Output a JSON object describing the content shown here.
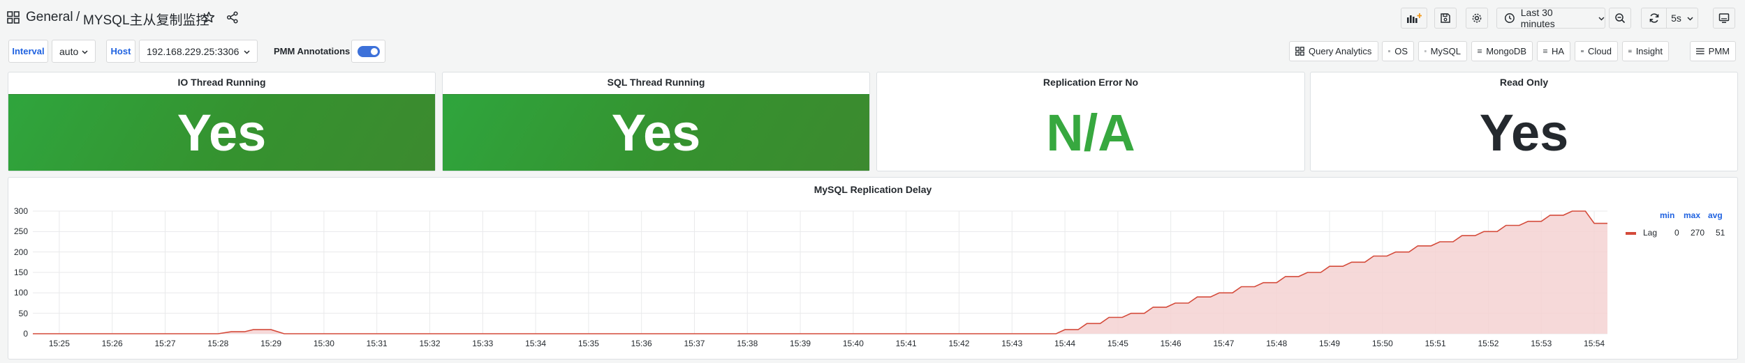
{
  "header": {
    "breadcrumb_root": "General",
    "breadcrumb_sep": "/",
    "dashboard_title": "MYSQL主从复制监控",
    "time_range": "Last 30 minutes",
    "refresh_interval": "5s"
  },
  "variables": {
    "interval_label": "Interval",
    "interval_value": "auto",
    "host_label": "Host",
    "host_value": "192.168.229.25:3306",
    "annotations_label": "PMM Annotations",
    "annotations_enabled": true
  },
  "links": [
    {
      "label": "Query Analytics",
      "icon": "apps-icon"
    },
    {
      "label": "OS",
      "icon": "bars-icon"
    },
    {
      "label": "MySQL",
      "icon": "bars-icon"
    },
    {
      "label": "MongoDB",
      "icon": "bars-icon"
    },
    {
      "label": "HA",
      "icon": "bars-icon"
    },
    {
      "label": "Cloud",
      "icon": "bars-icon"
    },
    {
      "label": "Insight",
      "icon": "bars-icon"
    },
    {
      "label": "PMM",
      "icon": "bars-icon"
    }
  ],
  "stats": [
    {
      "title": "IO Thread Running",
      "value": "Yes"
    },
    {
      "title": "SQL Thread Running",
      "value": "Yes"
    },
    {
      "title": "Replication Error No",
      "value": "N/A"
    },
    {
      "title": "Read Only",
      "value": "Yes"
    }
  ],
  "colors": {
    "ok_green": "#2fa53d",
    "na_green": "#37a83f",
    "lag_line": "#d44a3a",
    "lag_fill": "#f5d2d2",
    "accent_blue": "#1f62e0"
  },
  "chart_data": {
    "type": "area",
    "title": "MySQL Replication Delay",
    "xlabel": "",
    "ylabel": "",
    "ylim": [
      0,
      300
    ],
    "y_ticks": [
      "300",
      "250",
      "200",
      "150",
      "100",
      "50",
      "0"
    ],
    "x_ticks": [
      "15:25",
      "15:26",
      "15:27",
      "15:28",
      "15:29",
      "15:30",
      "15:31",
      "15:32",
      "15:33",
      "15:34",
      "15:35",
      "15:36",
      "15:37",
      "15:38",
      "15:39",
      "15:40",
      "15:41",
      "15:42",
      "15:43",
      "15:44",
      "15:45",
      "15:46",
      "15:47",
      "15:48",
      "15:49",
      "15:50",
      "15:51",
      "15:52",
      "15:53",
      "15:54"
    ],
    "grid": true,
    "legend_position": "right",
    "series": [
      {
        "name": "Lag",
        "color": "#d44a3a",
        "legend": {
          "min": "0",
          "max": "270",
          "avg": "51"
        },
        "points": [
          [
            "15:24:30",
            0
          ],
          [
            "15:28:00",
            0
          ],
          [
            "15:28:15",
            5
          ],
          [
            "15:28:30",
            5
          ],
          [
            "15:28:40",
            10
          ],
          [
            "15:29:00",
            10
          ],
          [
            "15:29:15",
            0
          ],
          [
            "15:43:50",
            0
          ],
          [
            "15:44:00",
            10
          ],
          [
            "15:44:15",
            10
          ],
          [
            "15:44:25",
            25
          ],
          [
            "15:44:40",
            25
          ],
          [
            "15:44:50",
            40
          ],
          [
            "15:45:05",
            40
          ],
          [
            "15:45:15",
            50
          ],
          [
            "15:45:30",
            50
          ],
          [
            "15:45:40",
            65
          ],
          [
            "15:45:55",
            65
          ],
          [
            "15:46:05",
            75
          ],
          [
            "15:46:20",
            75
          ],
          [
            "15:46:30",
            90
          ],
          [
            "15:46:45",
            90
          ],
          [
            "15:46:55",
            100
          ],
          [
            "15:47:10",
            100
          ],
          [
            "15:47:20",
            115
          ],
          [
            "15:47:35",
            115
          ],
          [
            "15:47:45",
            125
          ],
          [
            "15:48:00",
            125
          ],
          [
            "15:48:10",
            140
          ],
          [
            "15:48:25",
            140
          ],
          [
            "15:48:35",
            150
          ],
          [
            "15:48:50",
            150
          ],
          [
            "15:49:00",
            165
          ],
          [
            "15:49:15",
            165
          ],
          [
            "15:49:25",
            175
          ],
          [
            "15:49:40",
            175
          ],
          [
            "15:49:50",
            190
          ],
          [
            "15:50:05",
            190
          ],
          [
            "15:50:15",
            200
          ],
          [
            "15:50:30",
            200
          ],
          [
            "15:50:40",
            215
          ],
          [
            "15:50:55",
            215
          ],
          [
            "15:51:05",
            225
          ],
          [
            "15:51:20",
            225
          ],
          [
            "15:51:30",
            240
          ],
          [
            "15:51:45",
            240
          ],
          [
            "15:51:55",
            250
          ],
          [
            "15:52:10",
            250
          ],
          [
            "15:52:20",
            265
          ],
          [
            "15:52:35",
            265
          ],
          [
            "15:52:45",
            275
          ],
          [
            "15:53:00",
            275
          ],
          [
            "15:53:10",
            290
          ],
          [
            "15:53:25",
            290
          ],
          [
            "15:53:35",
            300
          ],
          [
            "15:53:50",
            300
          ],
          [
            "15:54:00",
            270
          ],
          [
            "15:54:15",
            270
          ]
        ]
      }
    ],
    "legend_columns": [
      "min",
      "max",
      "avg"
    ]
  }
}
